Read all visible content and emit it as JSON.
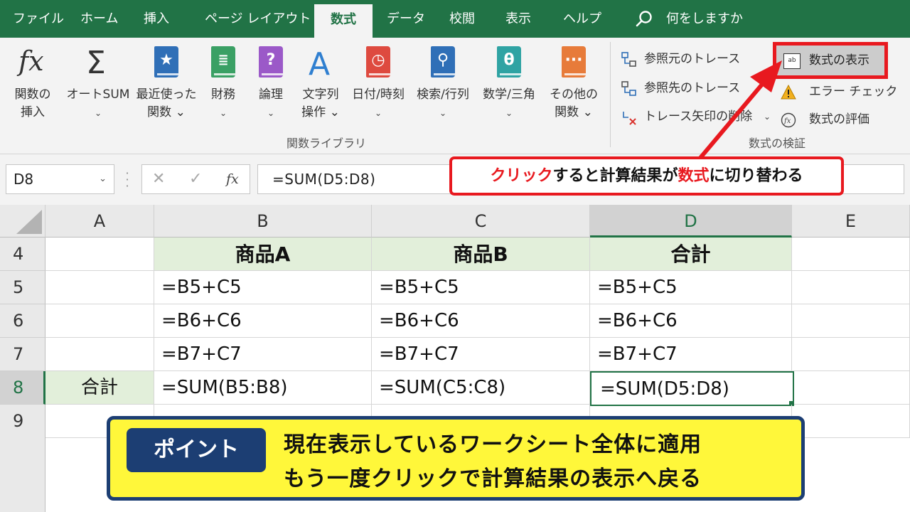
{
  "menu": {
    "tabs": [
      "ファイル",
      "ホーム",
      "挿入",
      "ページ レイアウト",
      "数式",
      "データ",
      "校閲",
      "表示",
      "ヘルプ"
    ],
    "active_tab": "数式",
    "tell_me": "何をしますか"
  },
  "ribbon": {
    "library_buttons": [
      {
        "line1": "関数の",
        "line2": "挿入",
        "icon": "fx-icon"
      },
      {
        "line1": "オートSUM",
        "line2": "⌄",
        "icon": "sigma-icon"
      },
      {
        "line1": "最近使った",
        "line2": "関数 ⌄",
        "icon": "star-book-icon"
      },
      {
        "line1": "財務",
        "line2": "⌄",
        "icon": "coins-book-icon"
      },
      {
        "line1": "論理",
        "line2": "⌄",
        "icon": "question-book-icon"
      },
      {
        "line1": "文字列",
        "line2": "操作 ⌄",
        "icon": "letter-a-icon"
      },
      {
        "line1": "日付/時刻",
        "line2": "⌄",
        "icon": "clock-book-icon"
      },
      {
        "line1": "検索/行列",
        "line2": "⌄",
        "icon": "magnifier-book-icon"
      },
      {
        "line1": "数学/三角",
        "line2": "⌄",
        "icon": "theta-book-icon"
      },
      {
        "line1": "その他の",
        "line2": "関数 ⌄",
        "icon": "more-book-icon"
      }
    ],
    "library_group_label": "関数ライブラリ",
    "audit": {
      "trace_precedents": "参照元のトレース",
      "trace_dependents": "参照先のトレース",
      "remove_arrows": "トレース矢印の削除",
      "remove_arrows_chevron": "⌄",
      "show_formulas": "数式の表示",
      "error_check": "エラー チェック",
      "error_check_chevron": "⌄",
      "evaluate_formula": "数式の評価",
      "group_label": "数式の検証"
    }
  },
  "formula_bar": {
    "name_box": "D8",
    "name_box_chevron": "⌄",
    "cancel": "✕",
    "enter": "✓",
    "fx": "fx",
    "formula": "=SUM(D5:D8)"
  },
  "sheet": {
    "columns": [
      "A",
      "B",
      "C",
      "D",
      "E"
    ],
    "selected_column": "D",
    "rows": [
      "4",
      "5",
      "6",
      "7",
      "8",
      "9"
    ],
    "selected_row": "8",
    "cells": {
      "B4": "商品A",
      "C4": "商品B",
      "D4": "合計",
      "B5": "=B5+C5",
      "C5": "=B5+C5",
      "D5": "=B5+C5",
      "B6": "=B6+C6",
      "C6": "=B6+C6",
      "D6": "=B6+C6",
      "B7": "=B7+C7",
      "C7": "=B7+C7",
      "D7": "=B7+C7",
      "A8": "合計",
      "B8": "=SUM(B5:B8)",
      "C8": "=SUM(C5:C8)",
      "D8": "=SUM(D5:D8)"
    }
  },
  "callout": {
    "part1": "クリック",
    "part2": "すると計算結果が",
    "part3": "数式",
    "part4": "に切り替わる"
  },
  "point": {
    "badge": "ポイント",
    "line1": "現在表示しているワークシート全体に適用",
    "line2": "もう一度クリックで計算結果の表示へ戻る"
  },
  "colors": {
    "excel_green": "#217346",
    "highlight_red": "#e8191f",
    "point_yellow": "#fff73a",
    "point_navy": "#1c3e73",
    "header_fill": "#e2efda"
  }
}
